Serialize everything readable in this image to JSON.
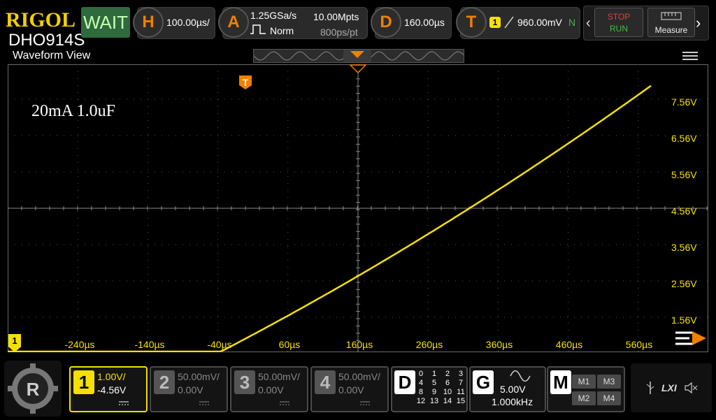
{
  "brand": {
    "logo": "RIGOL",
    "model": "DHO914S"
  },
  "status": "WAIT",
  "horizontal": {
    "icon_letter": "H",
    "timebase": "100.00µs/"
  },
  "acquire": {
    "icon_letter": "A",
    "sample_rate": "1.25GSa/s",
    "memory_depth": "10.00Mpts",
    "mode": "Norm",
    "resolution": "800ps/pt"
  },
  "delay": {
    "icon_letter": "D",
    "value": "160.00µs"
  },
  "trigger": {
    "icon_letter": "T",
    "source": "1",
    "level": "960.00mV",
    "sweep": "N"
  },
  "run_control": {
    "stop": "STOP",
    "run": "RUN"
  },
  "measure": {
    "label": "Measure"
  },
  "waveform_view": {
    "title": "Waveform View"
  },
  "annotation": "20mA 1.0uF",
  "trigger_marker": "T",
  "channel_marker": "1",
  "volt_labels": [
    "7.56V",
    "6.56V",
    "5.56V",
    "4.56V",
    "3.56V",
    "2.56V",
    "1.56V"
  ],
  "time_labels": [
    "-240µs",
    "-140µs",
    "-40µs",
    "60µs",
    "160µs",
    "260µs",
    "360µs",
    "460µs",
    "560µs"
  ],
  "channels": [
    {
      "num": "1",
      "scale": "1.00V/",
      "offset": "-4.56V",
      "active": true,
      "color": "#f5e000"
    },
    {
      "num": "2",
      "scale": "50.00mV/",
      "offset": "0.00V",
      "active": false,
      "color": "#777777"
    },
    {
      "num": "3",
      "scale": "50.00mV/",
      "offset": "0.00V",
      "active": false,
      "color": "#777777"
    },
    {
      "num": "4",
      "scale": "50.00mV/",
      "offset": "0.00V",
      "active": false,
      "color": "#777777"
    }
  ],
  "digital": {
    "label": "D",
    "bits": [
      "0",
      "1",
      "2",
      "3",
      "4",
      "5",
      "6",
      "7",
      "8",
      "9",
      "10",
      "11",
      "12",
      "13",
      "14",
      "15"
    ]
  },
  "generator": {
    "label": "G",
    "amplitude": "5.00V",
    "frequency": "1.000kHz"
  },
  "math": {
    "label": "M",
    "items": [
      "M1",
      "M3",
      "M2",
      "M4"
    ]
  },
  "footer": {
    "lxi": "LXI"
  },
  "colors": {
    "trace": "#f5e000",
    "accent": "#f08000",
    "status_bg": "#2e6a3e",
    "grid": "#5a5a5a"
  }
}
